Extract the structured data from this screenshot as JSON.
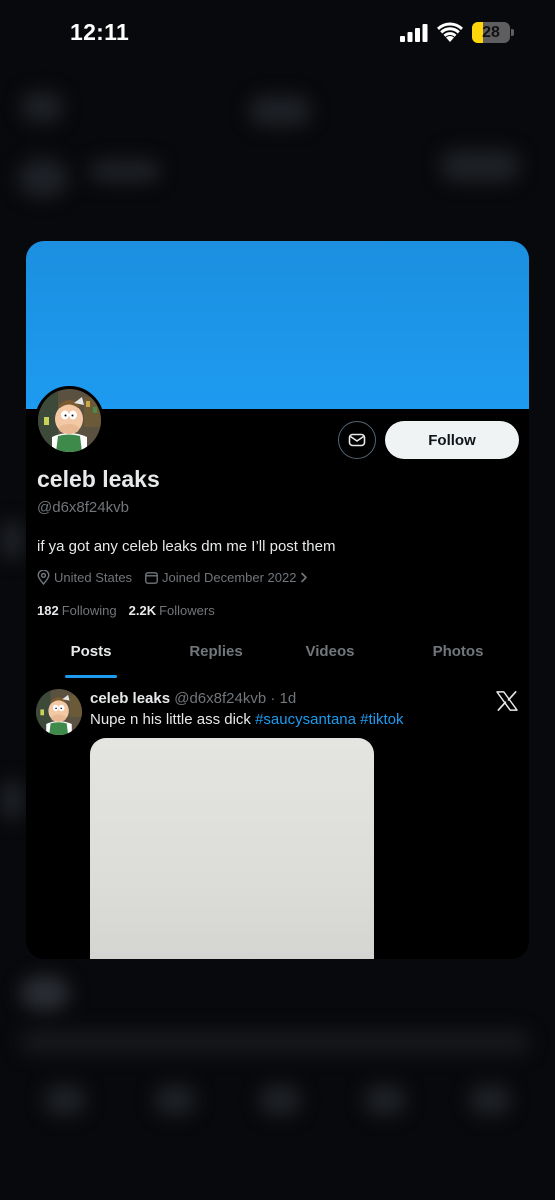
{
  "status_bar": {
    "time": "12:11",
    "battery_percent": "28",
    "battery_level": 0.28
  },
  "profile": {
    "display_name": "celeb leaks",
    "handle": "@d6x8f24kvb",
    "bio": "if ya got any celeb leaks dm me I’ll post them",
    "location": "United States",
    "joined": "Joined December 2022",
    "following_count": "182",
    "following_label": "Following",
    "followers_count": "2.2K",
    "followers_label": "Followers",
    "follow_label": "Follow",
    "avatar_icon": "cartoon-character-avatar",
    "banner_color": "#1d9bf0"
  },
  "tabs": [
    {
      "label": "Posts",
      "active": true
    },
    {
      "label": "Replies",
      "active": false
    },
    {
      "label": "Videos",
      "active": false
    },
    {
      "label": "Photos",
      "active": false
    }
  ],
  "post": {
    "author_name": "celeb leaks",
    "author_handle": "@d6x8f24kvb",
    "separator": "·",
    "time": "1d",
    "text": "Nupe n his little ass dick",
    "hashtags": [
      "#saucysantana",
      "#tiktok"
    ],
    "source_icon": "x-logo-icon"
  },
  "colors": {
    "accent": "#1d9bf0",
    "background": "#000000",
    "muted_text": "#71767b"
  }
}
